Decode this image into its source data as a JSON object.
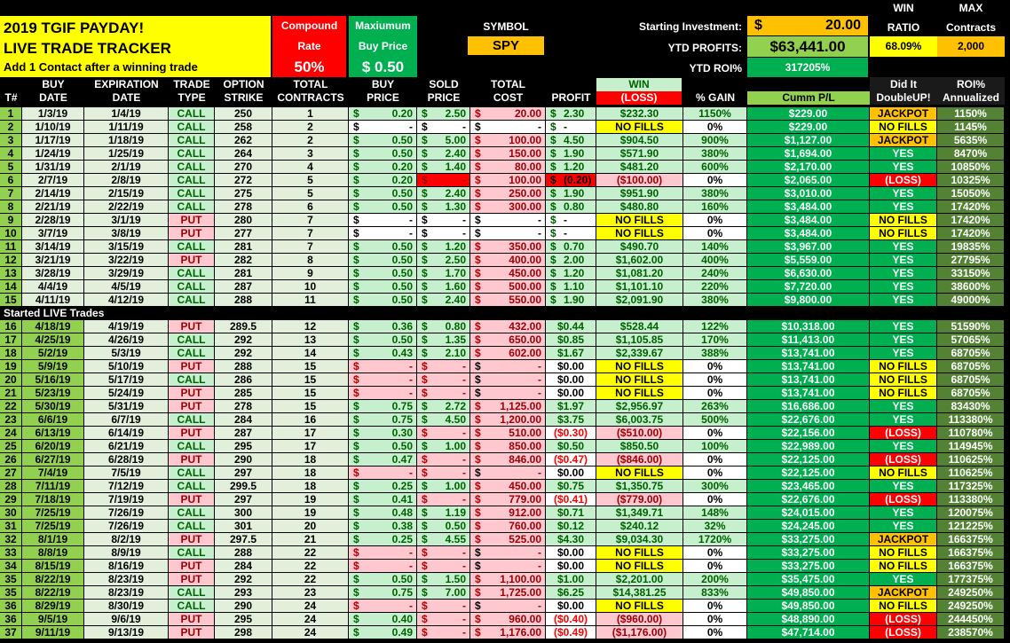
{
  "header": {
    "title_line1": "2019 TGIF PAYDAY!",
    "title_line2": "LIVE TRADE TRACKER",
    "subtitle": "Add 1 Contact after a winning trade",
    "compound_label1": "Compound",
    "compound_label2": "Rate",
    "compound_value": "50%",
    "maxbuy_label1": "Maxiumum",
    "maxbuy_label2": "Buy Price",
    "maxbuy_value": "$  0.50",
    "symbol_label": "SYMBOL",
    "symbol_value": "SPY",
    "starting_label": "Starting Investment:",
    "starting_currency": "$",
    "starting_value": "20.00",
    "ytd_profits_label": "YTD PROFITS:",
    "ytd_profits_value": "$63,441.00",
    "ytd_roi_label": "YTD ROI%",
    "ytd_roi_value": "317205%",
    "win_ratio_label1": "WIN",
    "win_ratio_label2": "RATIO",
    "win_ratio_value": "68.09%",
    "max_contracts_label1": "MAX",
    "max_contracts_label2": "Contracts",
    "max_contracts_value": "2,000"
  },
  "columns": [
    [
      "",
      "T#"
    ],
    [
      "BUY",
      "DATE"
    ],
    [
      "EXPIRATION",
      "DATE"
    ],
    [
      "TRADE",
      "TYPE"
    ],
    [
      "OPTION",
      "STRIKE"
    ],
    [
      "TOTAL",
      "CONTRACTS"
    ],
    [
      "BUY",
      "PRICE"
    ],
    [
      "SOLD",
      "PRICE"
    ],
    [
      "TOTAL",
      "COST"
    ],
    [
      "",
      "PROFIT"
    ],
    [
      "WIN",
      "(LOSS)"
    ],
    [
      "",
      "% GAIN"
    ],
    [
      "",
      "Cumm P/L"
    ],
    [
      "Did It",
      "DoubleUP!"
    ],
    [
      "ROI%",
      "Annualized"
    ]
  ],
  "section_label": "Started LIVE Trades",
  "sections": [
    {
      "rows": [
        [
          "1",
          "1/3/19",
          "1/4/19",
          "CALL",
          "250",
          "1",
          "0.20",
          "2.50",
          "20.00",
          "2.30",
          "$232.30",
          "1150%",
          "$229.00",
          "JACKPOT",
          "1150%"
        ],
        [
          "2",
          "1/10/19",
          "1/11/19",
          "CALL",
          "258",
          "2",
          "-",
          "-",
          "-",
          "-",
          "NO FILLS",
          "0%",
          "$229.00",
          "NO FILLS",
          "1145%"
        ],
        [
          "3",
          "1/17/19",
          "1/18/19",
          "CALL",
          "262",
          "2",
          "0.50",
          "5.00",
          "100.00",
          "4.50",
          "$904.50",
          "900%",
          "$1,127.00",
          "JACKPOT",
          "5635%"
        ],
        [
          "4",
          "1/24/19",
          "1/25/19",
          "CALL",
          "264",
          "3",
          "0.50",
          "2.40",
          "150.00",
          "1.90",
          "$571.90",
          "380%",
          "$1,694.00",
          "YES",
          "8470%"
        ],
        [
          "5",
          "1/31/19",
          "2/1/19",
          "CALL",
          "270",
          "4",
          "0.20",
          "1.40",
          "80.00",
          "1.20",
          "$481.20",
          "600%",
          "$2,170.00",
          "YES",
          "10850%"
        ],
        [
          "6",
          "2/7/19",
          "2/8/19",
          "CALL",
          "272",
          "5",
          "0.20",
          "-",
          "100.00",
          "(0.20)",
          "($100.00)",
          "0%",
          "$2,065.00",
          "(LOSS)",
          "10325%"
        ],
        [
          "7",
          "2/14/19",
          "2/15/19",
          "CALL",
          "275",
          "5",
          "0.50",
          "2.40",
          "250.00",
          "1.90",
          "$951.90",
          "380%",
          "$3,010.00",
          "YES",
          "15050%"
        ],
        [
          "8",
          "2/21/19",
          "2/22/19",
          "CALL",
          "278",
          "6",
          "0.50",
          "1.30",
          "300.00",
          "0.80",
          "$480.80",
          "160%",
          "$3,484.00",
          "YES",
          "17420%"
        ],
        [
          "9",
          "2/28/19",
          "3/1/19",
          "PUT",
          "280",
          "7",
          "-",
          "-",
          "-",
          "-",
          "NO FILLS",
          "0%",
          "$3,484.00",
          "NO FILLS",
          "17420%"
        ],
        [
          "10",
          "3/7/19",
          "3/8/19",
          "PUT",
          "277",
          "7",
          "-",
          "-",
          "-",
          "-",
          "NO FILLS",
          "0%",
          "$3,484.00",
          "NO FILLS",
          "17420%"
        ],
        [
          "11",
          "3/14/19",
          "3/15/19",
          "CALL",
          "281",
          "7",
          "0.50",
          "1.20",
          "350.00",
          "0.70",
          "$490.70",
          "140%",
          "$3,967.00",
          "YES",
          "19835%"
        ],
        [
          "12",
          "3/21/19",
          "3/22/19",
          "PUT",
          "282",
          "8",
          "0.50",
          "2.50",
          "400.00",
          "2.00",
          "$1,602.00",
          "400%",
          "$5,559.00",
          "YES",
          "27795%"
        ],
        [
          "13",
          "3/28/19",
          "3/29/19",
          "CALL",
          "281",
          "9",
          "0.50",
          "1.70",
          "450.00",
          "1.20",
          "$1,081.20",
          "240%",
          "$6,630.00",
          "YES",
          "33150%"
        ],
        [
          "14",
          "4/4/19",
          "4/5/19",
          "CALL",
          "287",
          "10",
          "0.50",
          "1.60",
          "500.00",
          "1.10",
          "$1,101.10",
          "220%",
          "$7,720.00",
          "YES",
          "38600%"
        ],
        [
          "15",
          "4/11/19",
          "4/12/19",
          "CALL",
          "288",
          "11",
          "0.50",
          "2.40",
          "550.00",
          "1.90",
          "$2,091.90",
          "380%",
          "$9,800.00",
          "YES",
          "49000%"
        ]
      ]
    },
    {
      "rows": [
        [
          "16",
          "4/18/19",
          "4/19/19",
          "PUT",
          "289.5",
          "12",
          "0.36",
          "0.80",
          "432.00",
          "$0.44",
          "$528.44",
          "122%",
          "$10,318.00",
          "YES",
          "51590%"
        ],
        [
          "17",
          "4/25/19",
          "4/26/19",
          "CALL",
          "292",
          "13",
          "0.50",
          "1.35",
          "650.00",
          "$0.85",
          "$1,105.85",
          "170%",
          "$11,413.00",
          "YES",
          "57065%"
        ],
        [
          "18",
          "5/2/19",
          "5/3/19",
          "CALL",
          "292",
          "14",
          "0.43",
          "2.10",
          "602.00",
          "$1.67",
          "$2,339.67",
          "388%",
          "$13,741.00",
          "YES",
          "68705%"
        ],
        [
          "19",
          "5/9/19",
          "5/10/19",
          "PUT",
          "288",
          "15",
          "-",
          "-",
          "-",
          "$0.00",
          "NO FILLS",
          "0%",
          "$13,741.00",
          "NO FILLS",
          "68705%"
        ],
        [
          "20",
          "5/16/19",
          "5/17/19",
          "CALL",
          "286",
          "15",
          "-",
          "-",
          "-",
          "$0.00",
          "NO FILLS",
          "0%",
          "$13,741.00",
          "NO FILLS",
          "68705%"
        ],
        [
          "21",
          "5/23/19",
          "5/24/19",
          "PUT",
          "285",
          "15",
          "-",
          "-",
          "-",
          "$0.00",
          "NO FILLS",
          "0%",
          "$13,741.00",
          "NO FILLS",
          "68705%"
        ],
        [
          "22",
          "5/30/19",
          "5/31/19",
          "PUT",
          "278",
          "15",
          "0.75",
          "2.72",
          "1,125.00",
          "$1.97",
          "$2,956.97",
          "263%",
          "$16,686.00",
          "YES",
          "83430%"
        ],
        [
          "23",
          "6/6/19",
          "6/7/19",
          "CALL",
          "284",
          "16",
          "0.75",
          "4.50",
          "1,200.00",
          "$3.75",
          "$6,003.75",
          "500%",
          "$22,676.00",
          "YES",
          "113380%"
        ],
        [
          "24",
          "6/13/19",
          "6/14/19",
          "PUT",
          "287",
          "17",
          "0.30",
          "-",
          "510.00",
          "($0.30)",
          "($510.00)",
          "0%",
          "$22,156.00",
          "(LOSS)",
          "110780%"
        ],
        [
          "25",
          "6/20/19",
          "6/21/19",
          "CALL",
          "295",
          "17",
          "0.50",
          "1.00",
          "850.00",
          "$0.50",
          "$850.50",
          "100%",
          "$22,989.00",
          "YES",
          "114945%"
        ],
        [
          "26",
          "6/27/19",
          "6/28/19",
          "PUT",
          "290",
          "18",
          "0.47",
          "-",
          "846.00",
          "($0.47)",
          "($846.00)",
          "0%",
          "$22,125.00",
          "(LOSS)",
          "110625%"
        ],
        [
          "27",
          "7/4/19",
          "7/5/19",
          "CALL",
          "297",
          "18",
          "-",
          "-",
          "-",
          "$0.00",
          "NO FILLS",
          "0%",
          "$22,125.00",
          "NO FILLS",
          "110625%"
        ],
        [
          "28",
          "7/11/19",
          "7/12/19",
          "CALL",
          "299.5",
          "18",
          "0.25",
          "1.00",
          "450.00",
          "$0.75",
          "$1,350.75",
          "300%",
          "$23,465.00",
          "YES",
          "117325%"
        ],
        [
          "29",
          "7/18/19",
          "7/19/19",
          "PUT",
          "297",
          "19",
          "0.41",
          "-",
          "779.00",
          "($0.41)",
          "($779.00)",
          "0%",
          "$22,676.00",
          "(LOSS)",
          "113380%"
        ],
        [
          "30",
          "7/25/19",
          "7/26/19",
          "CALL",
          "300",
          "19",
          "0.48",
          "1.19",
          "912.00",
          "$0.71",
          "$1,349.71",
          "148%",
          "$24,015.00",
          "YES",
          "120075%"
        ],
        [
          "31",
          "7/25/19",
          "7/26/19",
          "CALL",
          "301",
          "20",
          "0.38",
          "0.50",
          "760.00",
          "$0.12",
          "$240.12",
          "32%",
          "$24,245.00",
          "YES",
          "121225%"
        ],
        [
          "32",
          "8/1/19",
          "8/2/19",
          "PUT",
          "297.5",
          "21",
          "0.25",
          "4.55",
          "525.00",
          "$4.30",
          "$9,034.30",
          "1720%",
          "$33,275.00",
          "JACKPOT",
          "166375%"
        ],
        [
          "33",
          "8/8/19",
          "8/9/19",
          "CALL",
          "288",
          "22",
          "-",
          "-",
          "-",
          "$0.00",
          "NO FILLS",
          "0%",
          "$33,275.00",
          "NO FILLS",
          "166375%"
        ],
        [
          "34",
          "8/15/19",
          "8/16/19",
          "PUT",
          "284",
          "22",
          "-",
          "-",
          "-",
          "$0.00",
          "NO FILLS",
          "0%",
          "$33,275.00",
          "NO FILLS",
          "166375%"
        ],
        [
          "35",
          "8/22/19",
          "8/23/19",
          "PUT",
          "292",
          "22",
          "0.50",
          "1.50",
          "1,100.00",
          "$1.00",
          "$2,201.00",
          "200%",
          "$35,475.00",
          "YES",
          "177375%"
        ],
        [
          "35",
          "8/22/19",
          "8/23/19",
          "CALL",
          "293",
          "23",
          "0.75",
          "7.00",
          "1,725.00",
          "$6.25",
          "$14,381.25",
          "833%",
          "$49,850.00",
          "JACKPOT",
          "249250%"
        ],
        [
          "36",
          "8/29/19",
          "8/30/19",
          "CALL",
          "290",
          "24",
          "-",
          "-",
          "-",
          "$0.00",
          "NO FILLS",
          "0%",
          "$49,850.00",
          "NO FILLS",
          "249250%"
        ],
        [
          "36",
          "9/5/19",
          "9/6/19",
          "PUT",
          "295",
          "24",
          "0.40",
          "-",
          "960.00",
          "($0.40)",
          "($960.00)",
          "0%",
          "$48,890.00",
          "(LOSS)",
          "244450%"
        ],
        [
          "37",
          "9/11/19",
          "9/13/19",
          "PUT",
          "298",
          "24",
          "0.49",
          "-",
          "1,176.00",
          "($0.49)",
          "($1,176.00)",
          "0%",
          "$47,714.00",
          "(LOSS)",
          "238570%"
        ]
      ]
    }
  ],
  "colors": {
    "yellow": "#ffff00",
    "red": "#ff0000",
    "green": "#00b050",
    "lightgreen": "#92d050",
    "orange": "#ffc000",
    "olive": "#548235"
  }
}
